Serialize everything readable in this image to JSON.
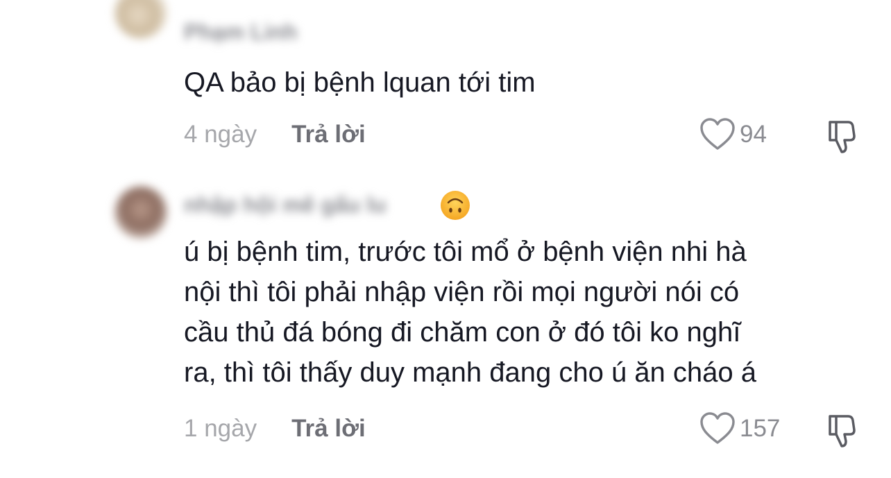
{
  "comments": [
    {
      "username": "Phạm Linh",
      "text": "QA bảo bị bệnh lquan tới tim",
      "time": "4 ngày",
      "reply_label": "Trả lời",
      "likes": "94",
      "icons": [
        "heart-icon",
        "dislike-icon"
      ]
    },
    {
      "username": "nhập hội mê gấu lu",
      "emoji": "upside-down-face",
      "text": "ú bị bệnh tim, trước tôi mổ ở bệnh viện nhi hà\nnội thì tôi phải nhập viện rồi mọi người nói có\ncầu thủ đá bóng đi chăm con ở đó tôi ko nghĩ\nra, thì tôi thấy duy mạnh đang cho ú ăn cháo á",
      "time": "1 ngày",
      "reply_label": "Trả lời",
      "likes": "157",
      "icons": [
        "heart-icon",
        "dislike-icon"
      ]
    }
  ],
  "colors": {
    "text": "#161823",
    "muted": "#a6a7ab",
    "secondary": "#6d6e75",
    "icon": "#8a8b91"
  }
}
